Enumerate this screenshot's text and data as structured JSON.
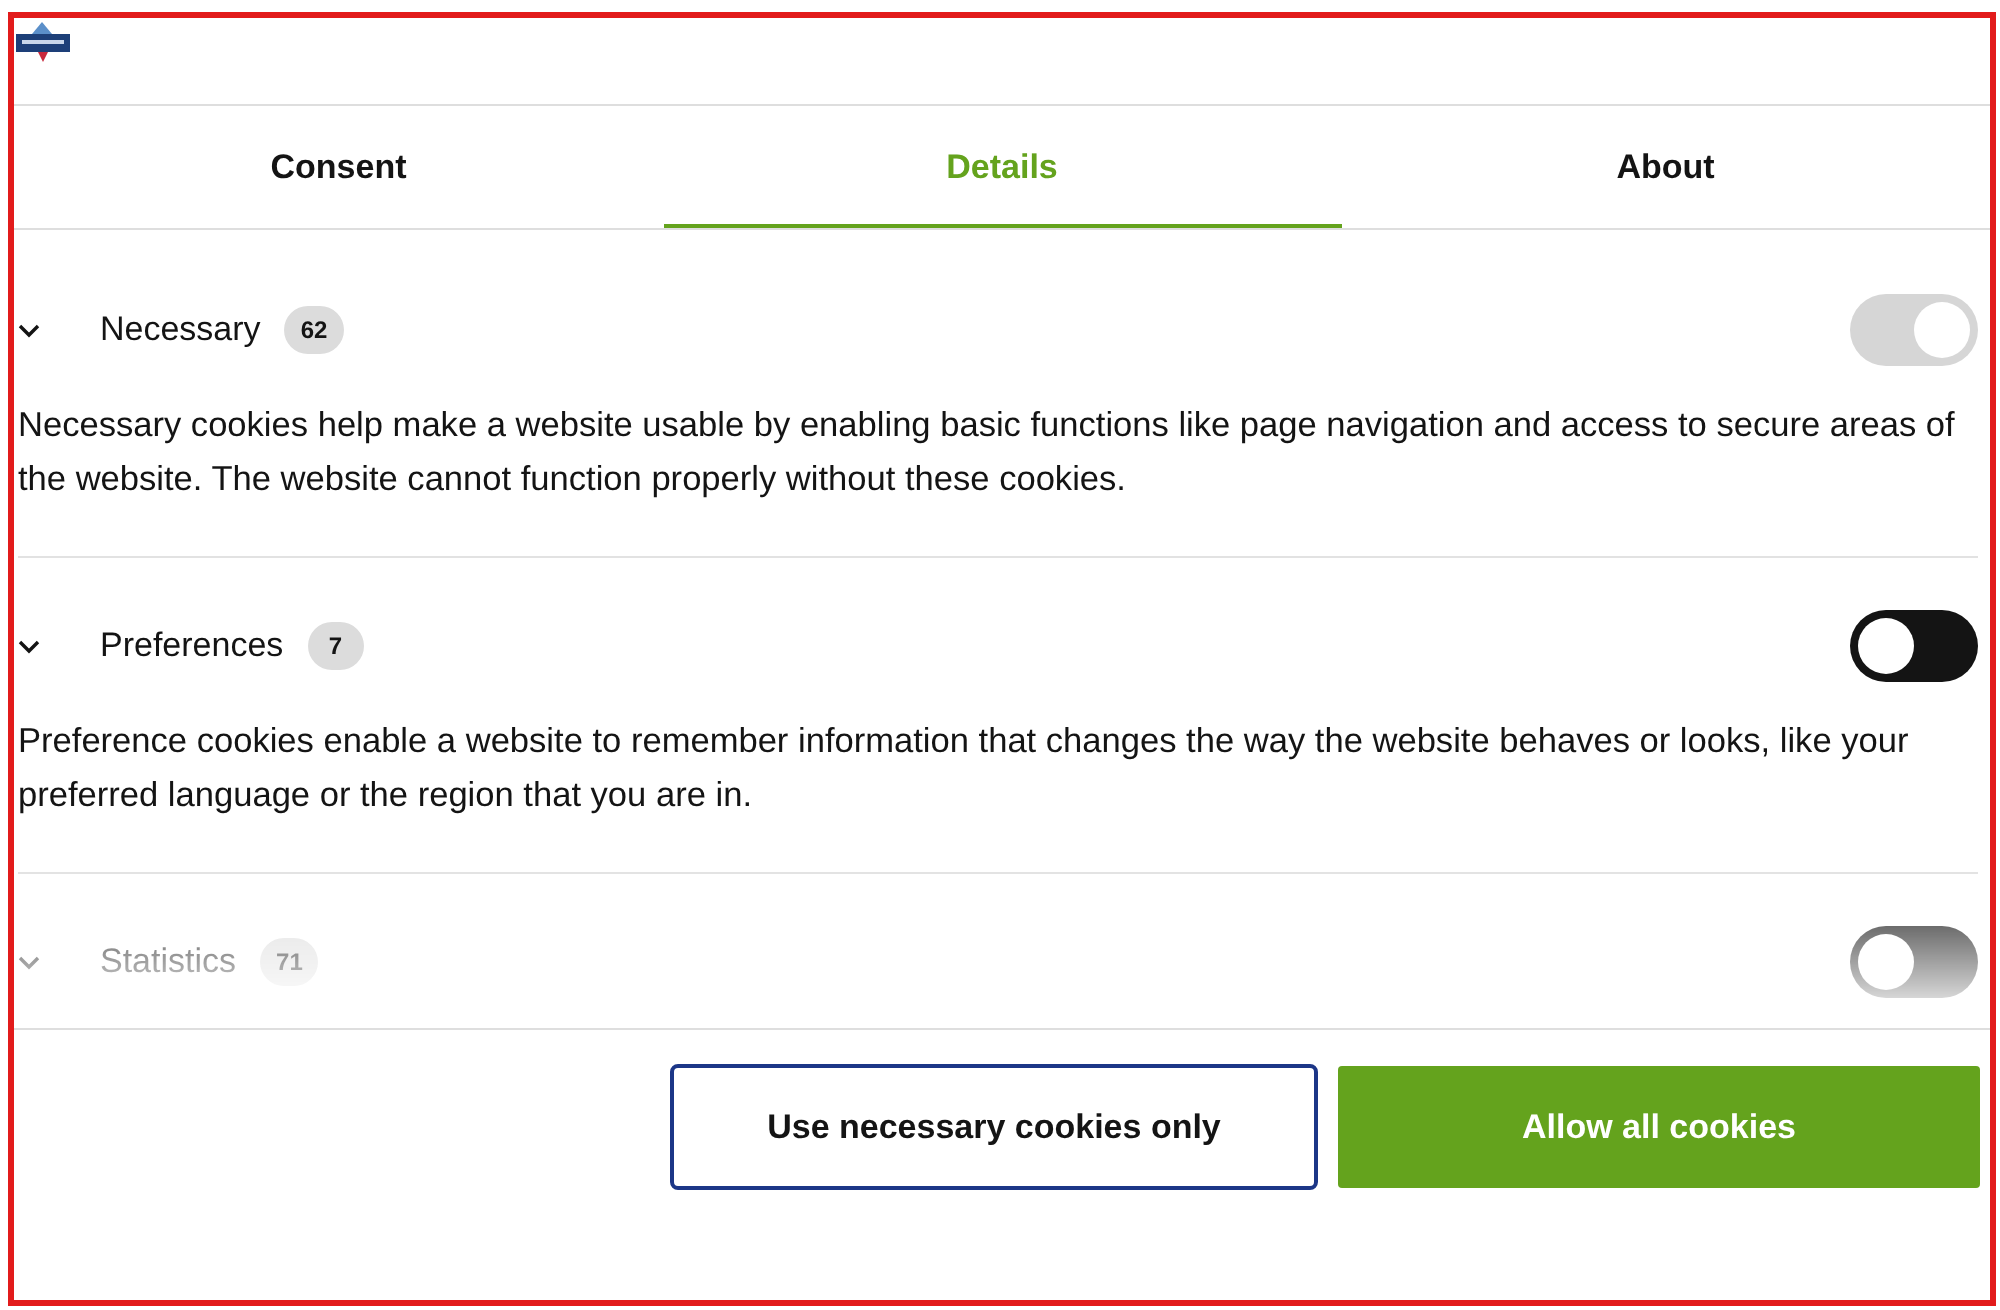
{
  "tabs": [
    {
      "label": "Consent",
      "selected": false
    },
    {
      "label": "Details",
      "selected": true
    },
    {
      "label": "About",
      "selected": false
    }
  ],
  "categories": [
    {
      "name": "Necessary",
      "count": "62",
      "expanded": true,
      "on": true,
      "disabled": true,
      "description": "Necessary cookies help make a website usable by enabling basic functions like page navigation and access to secure areas of the website. The website cannot function properly without these cookies."
    },
    {
      "name": "Preferences",
      "count": "7",
      "expanded": true,
      "on": false,
      "disabled": false,
      "description": "Preference cookies enable a website to remember information that changes the way the website behaves or looks, like your preferred language or the region that you are in."
    },
    {
      "name": "Statistics",
      "count": "71",
      "expanded": true,
      "on": false,
      "disabled": false
    }
  ],
  "buttons": [
    {
      "label": "Use necessary cookies only",
      "kind": "secondary"
    },
    {
      "label": "Allow all cookies",
      "kind": "primary"
    }
  ]
}
